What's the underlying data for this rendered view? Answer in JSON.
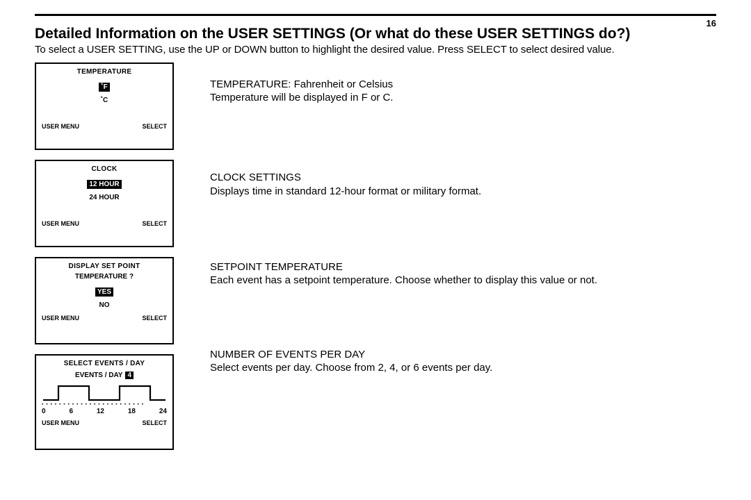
{
  "page_number": "16",
  "heading": "Detailed Information on the USER SETTINGS (Or what do these USER SETTINGS do?)",
  "intro": "To select a USER SETTING, use the UP or DOWN button to highlight the desired value. Press SELECT to select desired value.",
  "lcds": {
    "temp": {
      "title": "TEMPERATURE",
      "opt_sel": "˚F",
      "opt_unsel": "˚C",
      "footer_left": "USER MENU",
      "footer_right": "SELECT"
    },
    "clock": {
      "title": "CLOCK",
      "opt_sel": "12 HOUR",
      "opt_unsel": "24 HOUR",
      "footer_left": "USER MENU",
      "footer_right": "SELECT"
    },
    "setpoint": {
      "title": "DISPLAY SET POINT",
      "subtitle": "TEMPERATURE ?",
      "opt_sel": "YES",
      "opt_unsel": "NO",
      "footer_left": "USER MENU",
      "footer_right": "SELECT"
    },
    "events": {
      "title": "SELECT EVENTS / DAY",
      "row_label": "EVENTS / DAY",
      "row_value": "4",
      "ticks": {
        "t0": "0",
        "t1": "6",
        "t2": "12",
        "t3": "18",
        "t4": "24"
      },
      "footer_left": "USER MENU",
      "footer_right": "SELECT"
    }
  },
  "descs": {
    "temp_h": "TEMPERATURE: Fahrenheit or Celsius",
    "temp_b": "Temperature will be displayed in F or C.",
    "clock_h": "CLOCK SETTINGS",
    "clock_b": "Displays time in standard 12-hour format or military format.",
    "setpoint_h": "SETPOINT TEMPERATURE",
    "setpoint_b": "Each event has a setpoint temperature. Choose whether to display this value or not.",
    "events_h": "NUMBER OF EVENTS PER DAY",
    "events_b": "Select events per day. Choose from 2, 4, or 6 events per day."
  }
}
